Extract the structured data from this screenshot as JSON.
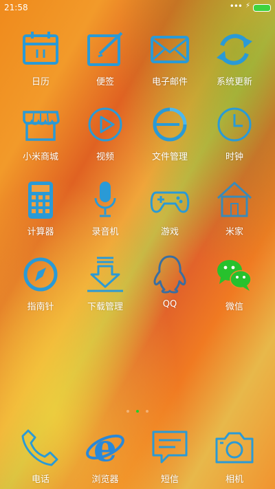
{
  "status": {
    "time": "21:58",
    "signal": "•••",
    "charging": "⚡"
  },
  "apps": [
    {
      "label": "日历"
    },
    {
      "label": "便签"
    },
    {
      "label": "电子邮件"
    },
    {
      "label": "系统更新"
    },
    {
      "label": "小米商城"
    },
    {
      "label": "视频"
    },
    {
      "label": "文件管理"
    },
    {
      "label": "时钟"
    },
    {
      "label": "计算器"
    },
    {
      "label": "录音机"
    },
    {
      "label": "游戏"
    },
    {
      "label": "米家"
    },
    {
      "label": "指南针"
    },
    {
      "label": "下载管理"
    },
    {
      "label": "QQ"
    },
    {
      "label": "微信"
    }
  ],
  "dock": [
    {
      "label": "电话"
    },
    {
      "label": "浏览器"
    },
    {
      "label": "短信"
    },
    {
      "label": "相机"
    }
  ],
  "pages": {
    "count": 3,
    "active": 2
  },
  "colors": {
    "icon_blue": "#2a9ad6",
    "wechat_green": "#27c12d",
    "battery": "#3fd33f",
    "page_dot_active": "#1fcf2d"
  }
}
